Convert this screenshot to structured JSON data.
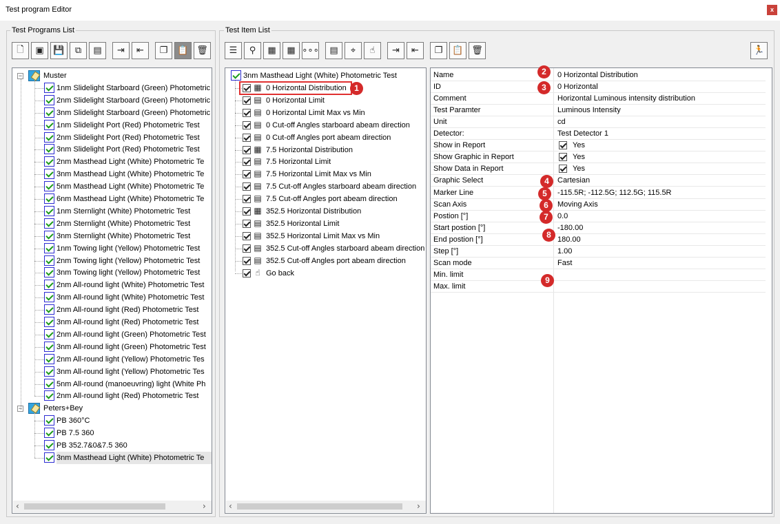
{
  "window": {
    "title": "Test program Editor",
    "close_label": "x"
  },
  "programs": {
    "label": "Test Programs List",
    "groups": [
      {
        "name": "Muster",
        "items": [
          "1nm Slidelight Starboard (Green) Photometric",
          "2nm Slidelight Starboard (Green) Photometric",
          "3nm Slidelight Starboard (Green) Photometric",
          "1nm Slidelight Port (Red) Photometric Test",
          "2nm Slidelight Port (Red) Photometric Test",
          "3nm Slidelight Port (Red) Photometric Test",
          "2nm Masthead Light (White) Photometric Te",
          "3nm Masthead Light (White) Photometric Te",
          "5nm Masthead Light (White) Photometric Te",
          "6nm Masthead Light (White) Photometric Te",
          "1nm Sternlight  (White) Photometric Test",
          "2nm Sternlight  (White) Photometric Test",
          "3nm Sternlight  (White) Photometric Test",
          "1nm Towing light (Yellow) Photometric Test",
          "2nm Towing light (Yellow) Photometric Test",
          "3nm Towing light (Yellow) Photometric Test",
          "2nm All-round light (White) Photometric Test",
          "3nm All-round light (White) Photometric Test",
          "2nm All-round light (Red) Photometric Test",
          "3nm All-round light (Red) Photometric Test",
          "2nm All-round light (Green) Photometric Test",
          "3nm All-round light (Green) Photometric Test",
          "2nm All-round light (Yellow) Photometric Tes",
          "3nm All-round light (Yellow) Photometric Tes",
          "5nm All-round (manoeuvring) light (White Ph",
          "2nm All-round light (Red) Photometric Test"
        ]
      },
      {
        "name": "Peters+Bey",
        "items": [
          "PB 360°C",
          "PB 7.5 360",
          "PB 352.7&0&7.5  360",
          "3nm Masthead Light (White) Photometric Te"
        ]
      }
    ]
  },
  "items_panel": {
    "label": "Test Item List",
    "root": "3nm Masthead Light (White) Photometric Test",
    "items": [
      {
        "label": "0 Horizontal Distribution",
        "icon": "distribution-icon",
        "glyph": "▦"
      },
      {
        "label": "0 Horizontal Limit",
        "icon": "calculator-icon",
        "glyph": "▤"
      },
      {
        "label": "0 Horizontal Limit Max vs Min",
        "icon": "calculator-icon",
        "glyph": "▤"
      },
      {
        "label": "0 Cut-off Angles starboard abeam direction",
        "icon": "calculator-icon",
        "glyph": "▤"
      },
      {
        "label": "0 Cut-off Angles port abeam direction",
        "icon": "calculator-icon",
        "glyph": "▤"
      },
      {
        "label": "7.5 Horizontal Distribution",
        "icon": "distribution-icon",
        "glyph": "▦"
      },
      {
        "label": "7.5 Horizontal Limit",
        "icon": "calculator-icon",
        "glyph": "▤"
      },
      {
        "label": "7.5 Horizontal Limit Max vs Min",
        "icon": "calculator-icon",
        "glyph": "▤"
      },
      {
        "label": "7.5 Cut-off Angles starboard abeam direction",
        "icon": "calculator-icon",
        "glyph": "▤"
      },
      {
        "label": "7.5 Cut-off Angles port abeam direction",
        "icon": "calculator-icon",
        "glyph": "▤"
      },
      {
        "label": "352.5 Horizontal Distribution",
        "icon": "distribution-icon",
        "glyph": "▦"
      },
      {
        "label": "352.5 Horizontal Limit",
        "icon": "calculator-icon",
        "glyph": "▤"
      },
      {
        "label": "352.5 Horizontal Limit Max vs Min",
        "icon": "calculator-icon",
        "glyph": "▤"
      },
      {
        "label": "352.5 Cut-off Angles starboard abeam direction",
        "icon": "calculator-icon",
        "glyph": "▤"
      },
      {
        "label": "352.5 Cut-off Angles port abeam direction",
        "icon": "calculator-icon",
        "glyph": "▤"
      },
      {
        "label": "Go back",
        "icon": "hand-pointer-icon",
        "glyph": "☝"
      }
    ]
  },
  "properties": [
    {
      "name": "Name",
      "value": "0 Horizontal Distribution"
    },
    {
      "name": "ID",
      "value": "0 Horizontal"
    },
    {
      "name": "Comment",
      "value": "Horizontal Luminous intensity distribution"
    },
    {
      "name": "Test Paramter",
      "value": "Luminous Intensity"
    },
    {
      "name": "Unit",
      "value": "cd"
    },
    {
      "name": "Detector:",
      "value": "Test Detector 1"
    },
    {
      "name": "Show in Report",
      "value": "Yes",
      "checkbox": true
    },
    {
      "name": "Show Graphic in Report",
      "value": "Yes",
      "checkbox": true
    },
    {
      "name": "Show Data in Report",
      "value": "Yes",
      "checkbox": true
    },
    {
      "name": "Graphic Select",
      "value": "Cartesian"
    },
    {
      "name": "Marker Line",
      "value": "-115.5R; -112.5G; 112.5G; 115.5R"
    },
    {
      "name": "Scan Axis",
      "value": "Moving Axis"
    },
    {
      "name": "Postion [°]",
      "value": "0.0"
    },
    {
      "name": "Start postion [°]",
      "value": "-180.00"
    },
    {
      "name": "End postion [°]",
      "value": "180.00"
    },
    {
      "name": "Step [°]",
      "value": "1.00"
    },
    {
      "name": "Scan mode",
      "value": "Fast"
    },
    {
      "name": "Min. limit",
      "value": ""
    },
    {
      "name": "Max. limit",
      "value": ""
    }
  ],
  "badges": [
    "1",
    "2",
    "3",
    "4",
    "5",
    "6",
    "7",
    "8",
    "9"
  ],
  "toolbar_left": [
    {
      "icon": "new-program-icon",
      "glyph": "🗋"
    },
    {
      "icon": "program-properties-icon",
      "glyph": "▣"
    },
    {
      "icon": "save-icon",
      "glyph": "💾"
    },
    {
      "icon": "add-copy-icon",
      "glyph": "⧉"
    },
    {
      "icon": "add-list-icon",
      "glyph": "▤"
    },
    {
      "icon": "move-in-icon",
      "glyph": "⇥"
    },
    {
      "icon": "move-out-icon",
      "glyph": "⇤"
    },
    {
      "icon": "copy-icon",
      "glyph": "❐"
    },
    {
      "icon": "paste-icon",
      "glyph": "📋"
    },
    {
      "icon": "delete-icon",
      "glyph": "🗑"
    }
  ],
  "toolbar_mid": [
    {
      "icon": "list-view-icon",
      "glyph": "☰"
    },
    {
      "icon": "detector-icon",
      "glyph": "⚲"
    },
    {
      "icon": "distribution-icon",
      "glyph": "▦"
    },
    {
      "icon": "table-icon",
      "glyph": "▦"
    },
    {
      "icon": "dots-icon",
      "glyph": "∘∘∘"
    },
    {
      "icon": "calculator-icon",
      "glyph": "▤"
    },
    {
      "icon": "target-icon",
      "glyph": "⌖"
    },
    {
      "icon": "hand-pointer-icon",
      "glyph": "☝"
    },
    {
      "icon": "move-in-icon",
      "glyph": "⇥"
    },
    {
      "icon": "move-out-icon",
      "glyph": "⇤"
    },
    {
      "icon": "copy-icon",
      "glyph": "❐"
    },
    {
      "icon": "paste-icon",
      "glyph": "📋"
    },
    {
      "icon": "delete-icon",
      "glyph": "🗑"
    }
  ],
  "toolbar_right": {
    "icon": "run-test-icon",
    "glyph": "🏃"
  },
  "scroll": {
    "left_arrow": "‹",
    "right_arrow": "›"
  }
}
